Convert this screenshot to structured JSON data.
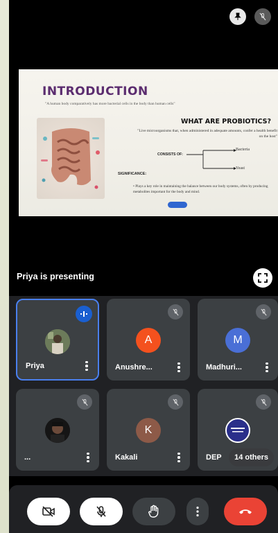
{
  "presenter_label": "Priya is presenting",
  "slide": {
    "title": "INTRODUCTION",
    "quote": "\"A human body comparatively has more bacterial cells in the body than human cells\"",
    "heading": "WHAT ARE PROBIOTICS?",
    "definition": "\"Live microorganisms that, when administered in adequate amounts, confer a health benefit on the host\"",
    "consists_label": "CONSISTS OF:",
    "branches": [
      "Bacteria",
      "Yeast"
    ],
    "significance_label": "SIGNIFICANCE:",
    "significance_text": "Plays a key role in maintaining the balance between our body systems, often by producing metabolites important for the body and mind."
  },
  "participants": [
    {
      "name": "Priya",
      "speaking": true
    },
    {
      "name": "Anushre...",
      "initial": "A",
      "color": "#f4511e",
      "muted": true
    },
    {
      "name": "Madhuri...",
      "initial": "M",
      "color": "#4a6fd6",
      "muted": true
    },
    {
      "name": "...",
      "muted": true
    },
    {
      "name": "Kakali",
      "initial": "K",
      "color": "#8d5a48",
      "muted": true
    },
    {
      "name": "DEP",
      "muted": true
    }
  ],
  "others_label": "14 others",
  "controls": {
    "camera": "camera-off-icon",
    "mic": "mic-off-icon",
    "hand": "raise-hand-icon",
    "more": "more-vert-icon",
    "end": "end-call-icon"
  },
  "colors": {
    "accent": "#1a5fd0",
    "end_call": "#ea4335",
    "tile": "#3c4043"
  }
}
